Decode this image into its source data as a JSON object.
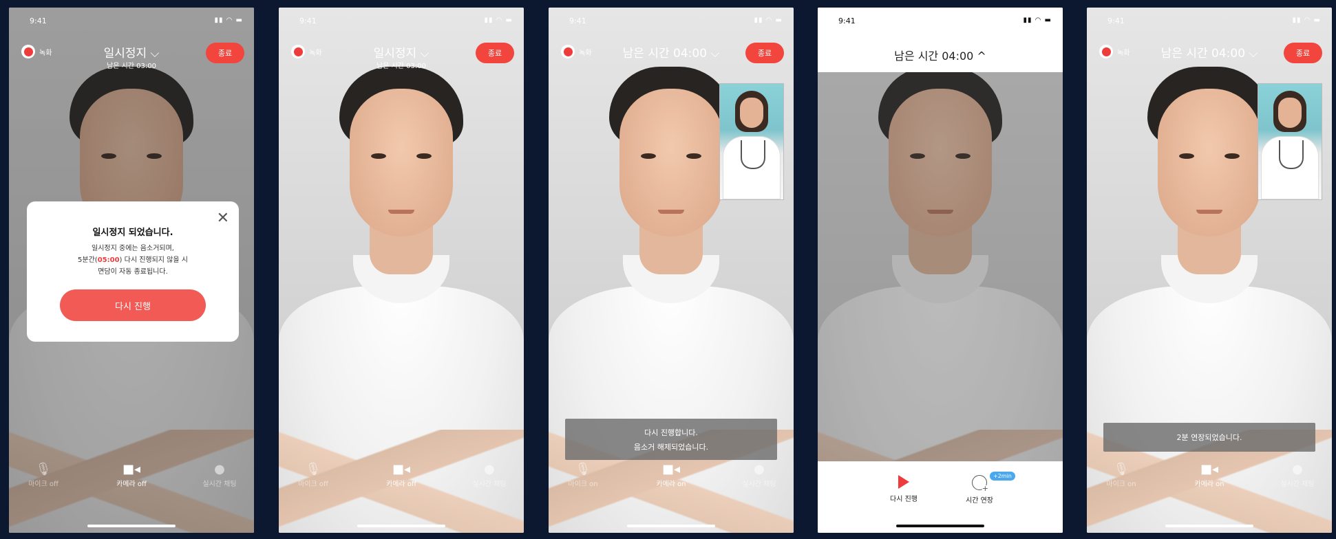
{
  "status_time": "9:41",
  "status_icons": "▮▮ ◠ ▬",
  "screens": [
    {
      "record_label": "녹화",
      "title": "일시정지 ⌵",
      "subtitle": "남은 시간 03:00",
      "end_label": "종료",
      "modal": {
        "title": "일시정지 되었습니다.",
        "line1": "일시정지 중에는 음소거되며,",
        "line2_pre": "5분간(",
        "line2_highlight": "05:00",
        "line2_post": ") 다시 진행되지 않을 시",
        "line3": "면담이 자동 종료됩니다.",
        "button": "다시 진행"
      },
      "controls": [
        "마이크 off",
        "카메라 off",
        "실시간 채팅"
      ]
    },
    {
      "record_label": "녹화",
      "title": "일시정지 ⌵",
      "subtitle": "남은 시간 03:00",
      "end_label": "종료",
      "controls": [
        "마이크 off",
        "카메라 off",
        "실시간 채팅"
      ]
    },
    {
      "record_label": "녹화",
      "title": "남은 시간 04:00 ⌵",
      "end_label": "종료",
      "toast": [
        "다시 진행합니다.",
        "음소거 해제되었습니다."
      ],
      "controls": [
        "마이크 on",
        "카메라 on",
        "실시간 채팅"
      ]
    },
    {
      "title": "남은 시간 04:00 ^",
      "buttons": [
        "다시 진행",
        "시간 연장"
      ],
      "badge": "+2min"
    },
    {
      "record_label": "녹화",
      "title": "남은 시간 04:00 ⌵",
      "end_label": "종료",
      "toast": "2분 연장되었습니다.",
      "controls": [
        "마이크 on",
        "카메라 on",
        "실시간 채팅"
      ]
    }
  ]
}
